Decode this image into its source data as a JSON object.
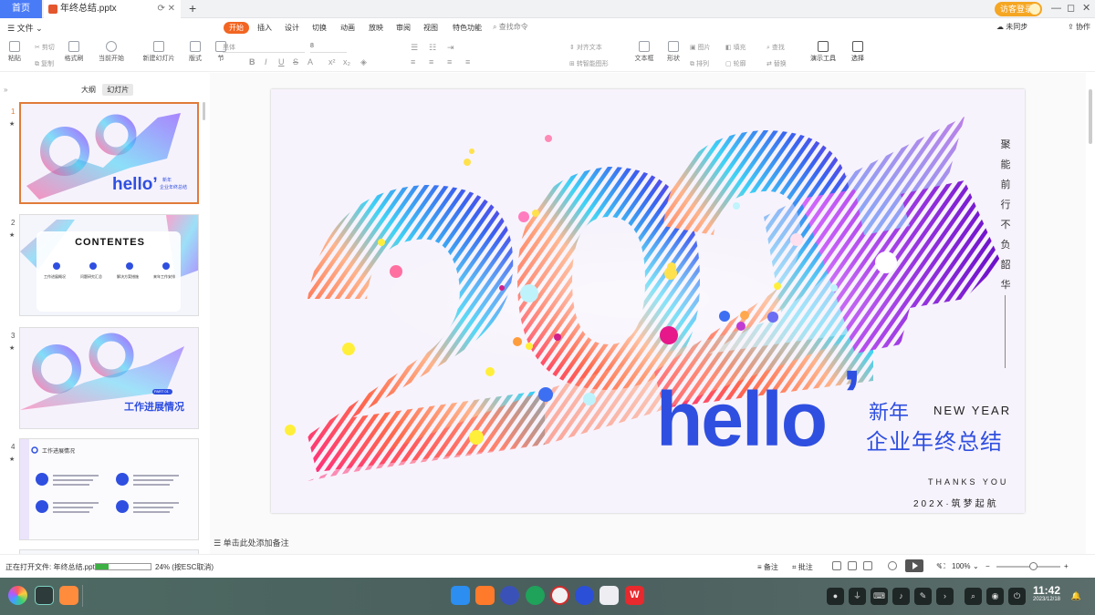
{
  "tabs": {
    "home": "首页",
    "doc_title": "年终总结.pptx",
    "new_tab": "+"
  },
  "user": {
    "visitor_label": "访客登录"
  },
  "window": {
    "min": "—",
    "max": "◻",
    "close": "✕"
  },
  "menu": {
    "file": "☰ 文件 ⌄",
    "tabs": [
      "开始",
      "插入",
      "设计",
      "切换",
      "动画",
      "放映",
      "审阅",
      "视图",
      "特色功能"
    ],
    "search": "查找命令",
    "unsync": "未同步",
    "collab": "协作"
  },
  "ribbon": {
    "paste": "粘贴",
    "cut": "剪切",
    "copy": "复制",
    "format_painter": "格式刷",
    "from_current": "当前开始",
    "new_slide": "新建幻灯片",
    "layout": "版式",
    "section": "节",
    "font_placeholder": "黑体",
    "font_size": "8",
    "align_text": "对齐文本",
    "smart_shape": "转智能图形",
    "textbox": "文本框",
    "shape": "形状",
    "arrange": "排列",
    "outline": "轮廓",
    "picture": "图片",
    "fill": "填充",
    "find": "查找",
    "replace": "替换",
    "presenter": "演示工具",
    "select": "选择"
  },
  "panel": {
    "outline_tab": "大纲",
    "slides_tab": "幻灯片",
    "slide_numbers": [
      "1",
      "2",
      "3",
      "4"
    ],
    "thumb2_title": "CONTENTES",
    "thumb2_items": [
      "工作进展概况",
      "问题研究汇总",
      "解决方案措施",
      "来年工作安排"
    ],
    "thumb3_title": "工作进展情况",
    "thumb3_part": "PART 01",
    "thumb4_title": "工作进展情况"
  },
  "slide": {
    "hello": "hello",
    "apostrophe": "’",
    "new_year_cn": "新年",
    "new_year_en": "NEW YEAR",
    "subtitle": "企业年终总结",
    "thanks": "THANKS YOU",
    "tagline": "202X·筑梦起航",
    "vertical_slogan": [
      "聚",
      "能",
      "前",
      "行",
      "不",
      "负",
      "韶",
      "华"
    ],
    "accent_color": "#2f4fe0"
  },
  "notes": {
    "placeholder": "单击此处添加备注"
  },
  "status": {
    "opening": "正在打开文件: 年终总结.pptx",
    "progress_fraction": 0.24,
    "progress_pct": "24%",
    "cancel_hint": "(按ESC取消)",
    "notes_btn": "备注",
    "comments_btn": "批注",
    "zoom": "100%",
    "zoom_minus": "−",
    "zoom_plus": "+"
  },
  "clock": {
    "time": "11:42",
    "date": "2023/12/18"
  }
}
